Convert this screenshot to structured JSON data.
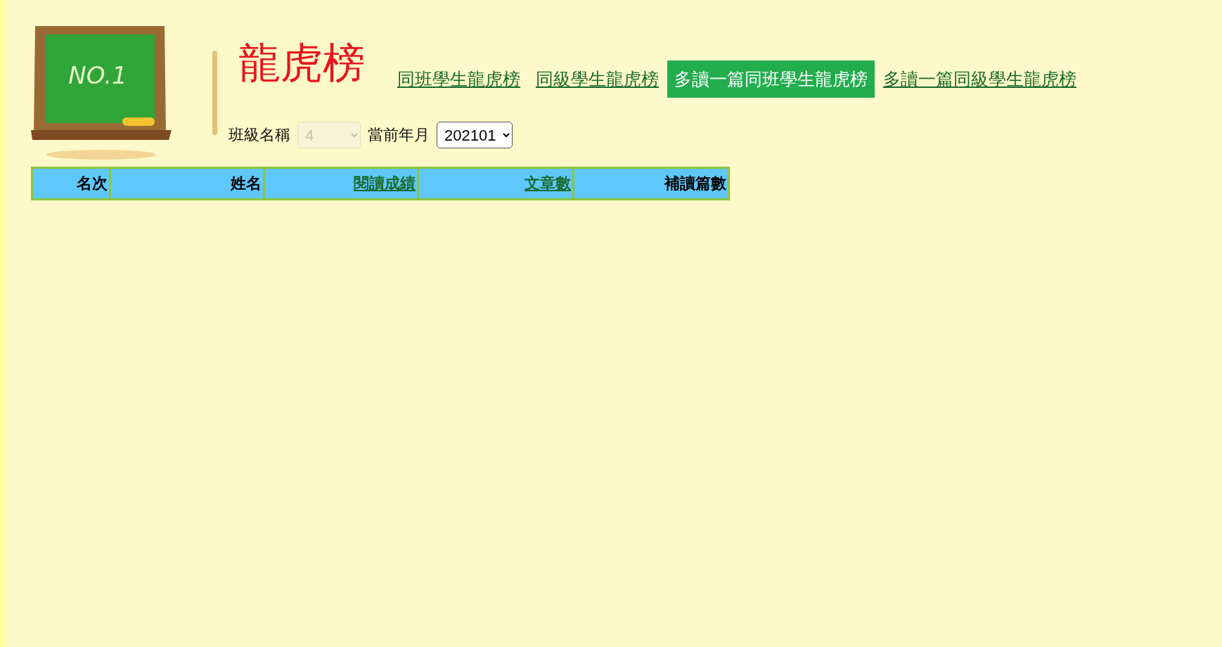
{
  "logo": {
    "board_text": "NO.1"
  },
  "title": "龍虎榜",
  "tabs": [
    {
      "label": "同班學生龍虎榜",
      "selected": false
    },
    {
      "label": "同級學生龍虎榜",
      "selected": false
    },
    {
      "label": "多讀一篇同班學生龍虎榜",
      "selected": true
    },
    {
      "label": "多讀一篇同級學生龍虎榜",
      "selected": false
    }
  ],
  "filters": [
    {
      "label": "班級名稱",
      "value": "4",
      "disabled": true
    },
    {
      "label": "當前年月",
      "value": "202101",
      "disabled": false
    }
  ],
  "table": {
    "columns": [
      {
        "label": "名次",
        "kind": "text"
      },
      {
        "label": "姓名",
        "kind": "text"
      },
      {
        "label": "閱讀成績",
        "kind": "link"
      },
      {
        "label": "文章數",
        "kind": "link"
      },
      {
        "label": "補讀篇數",
        "kind": "text"
      }
    ]
  }
}
